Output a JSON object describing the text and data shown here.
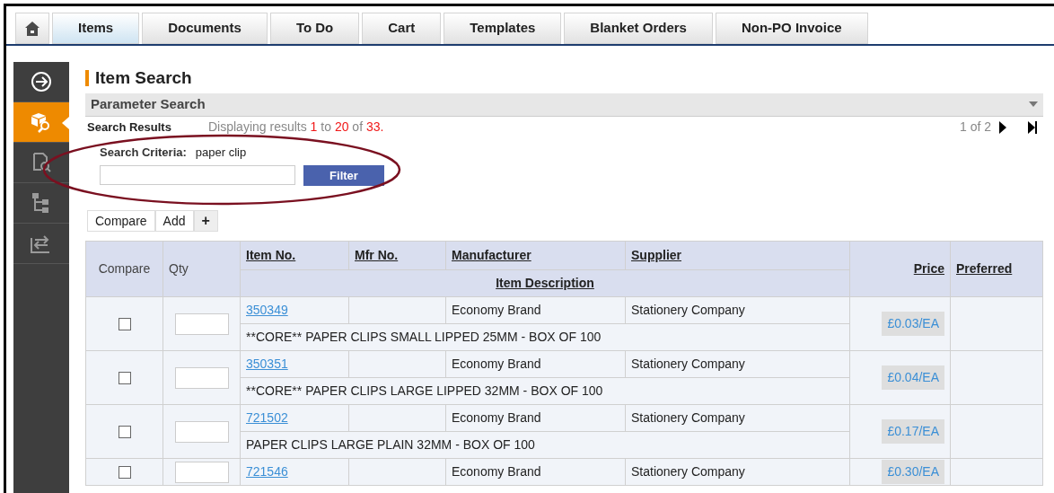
{
  "tabs": [
    {
      "label": "Items",
      "selected": true
    },
    {
      "label": "Documents",
      "selected": false
    },
    {
      "label": "To Do",
      "selected": false
    },
    {
      "label": "Cart",
      "selected": false
    },
    {
      "label": "Templates",
      "selected": false
    },
    {
      "label": "Blanket Orders",
      "selected": false
    },
    {
      "label": "Non-PO Invoice",
      "selected": false
    }
  ],
  "sidebar": {
    "items": [
      {
        "kind": "arrow",
        "selected": false
      },
      {
        "kind": "search",
        "selected": true
      },
      {
        "kind": "document",
        "selected": false
      },
      {
        "kind": "tree",
        "selected": false
      },
      {
        "kind": "swap",
        "selected": false
      }
    ]
  },
  "title": "Item Search",
  "parameter_search": {
    "label": "Parameter Search",
    "expanded": false
  },
  "results": {
    "label": "Search Results",
    "summary": "Displaying results **1** to **20** of **33.**",
    "pagination": "1 of 2"
  },
  "search_criteria": {
    "label": "Search Criteria:",
    "value": "paper clip",
    "filter_button": "Filter"
  },
  "actions": {
    "compare": "Compare",
    "add": "Add",
    "plus": "+"
  },
  "table": {
    "columns": {
      "compare": "Compare",
      "qty": "Qty",
      "item_no": "Item No.",
      "mfr_no": "Mfr No.",
      "manufacturer": "Manufacturer",
      "supplier": "Supplier",
      "description": "Item Description",
      "price": "Price",
      "preferred": "Preferred"
    },
    "rows": [
      {
        "checked": false,
        "item_no": "350349",
        "manufacturer": "Economy Brand",
        "supplier": "Stationery Company",
        "description": "**CORE** PAPER CLIPS SMALL LIPPED 25MM - BOX OF 100",
        "price": "£0.03/EA"
      },
      {
        "checked": false,
        "item_no": "350351",
        "manufacturer": "Economy Brand",
        "supplier": "Stationery Company",
        "description": "**CORE** PAPER CLIPS LARGE LIPPED 32MM - BOX OF 100",
        "price": "£0.04/EA"
      },
      {
        "checked": false,
        "item_no": "721502",
        "manufacturer": "Economy Brand",
        "supplier": "Stationery Company",
        "description": "PAPER CLIPS LARGE PLAIN 32MM - BOX OF 100",
        "price": "£0.17/EA"
      },
      {
        "checked": false,
        "item_no": "721546",
        "manufacturer": "Economy Brand",
        "supplier": "Stationery Company",
        "price": "£0.30/EA"
      }
    ]
  }
}
